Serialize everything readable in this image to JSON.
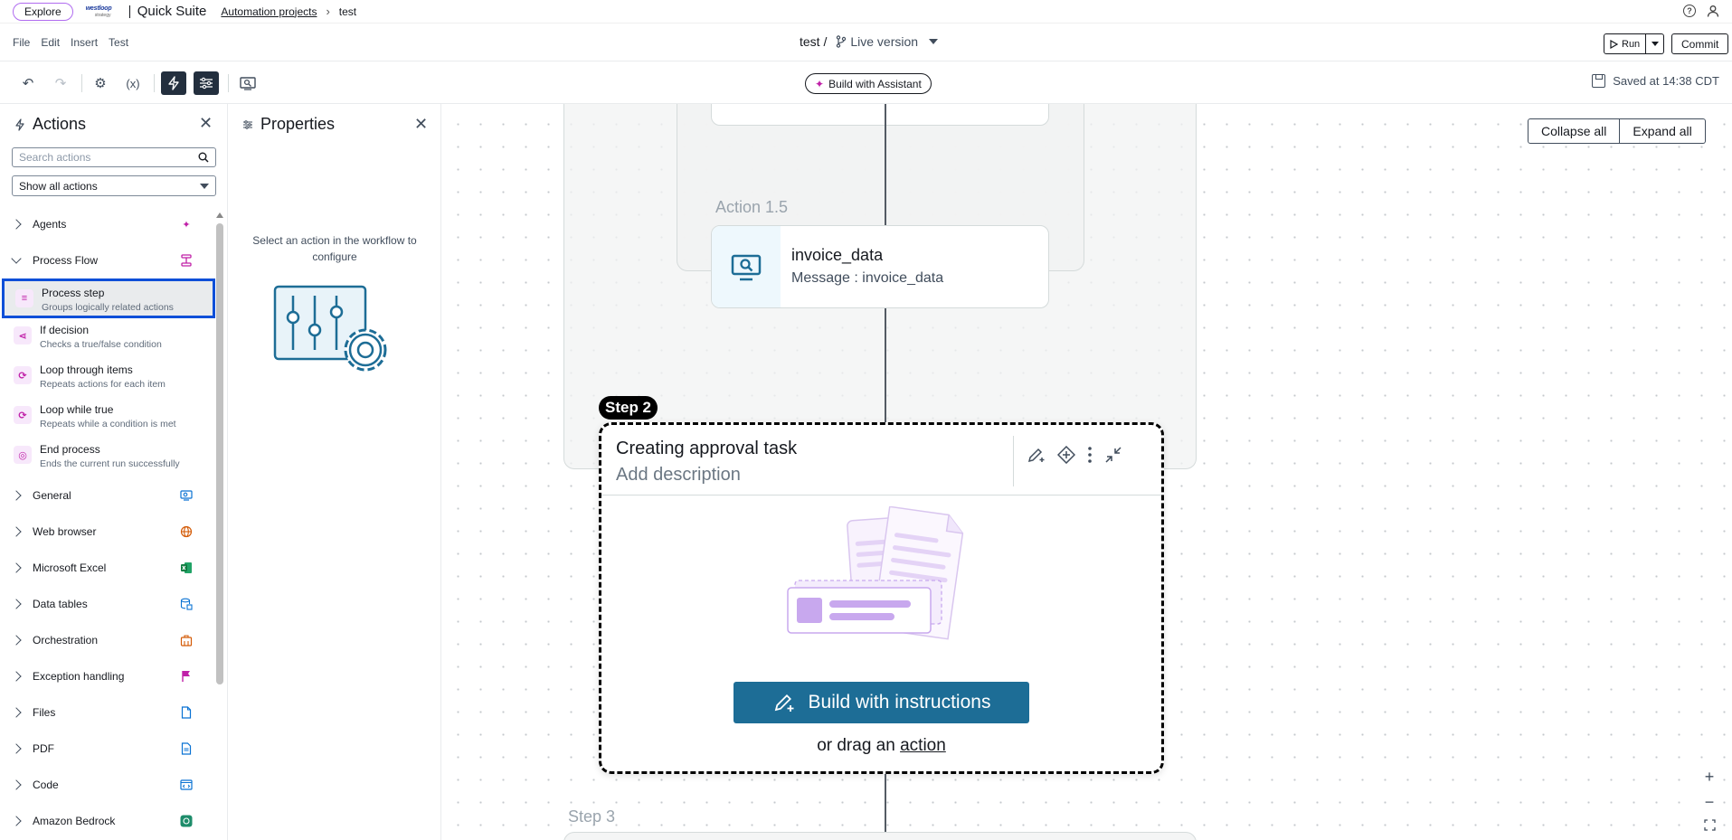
{
  "topbar": {
    "explore": "Explore",
    "logo_main": "westloop",
    "logo_sub": "strategy",
    "suite": "Quick Suite",
    "breadcrumb_link": "Automation projects",
    "breadcrumb_current": "test"
  },
  "menubar": {
    "menus": [
      "File",
      "Edit",
      "Insert",
      "Test"
    ],
    "project": "test /",
    "version": "Live version",
    "run": "Run",
    "commit": "Commit"
  },
  "toolbar": {
    "assistant": "Build with Assistant",
    "saved": "Saved at 14:38 CDT"
  },
  "actions": {
    "title": "Actions",
    "search_placeholder": "Search actions",
    "filter": "Show all actions",
    "categories": [
      {
        "label": "Agents",
        "icon": "sparkle-icon",
        "color": "#c020a8"
      },
      {
        "label": "Process Flow",
        "icon": "process-flow-icon",
        "color": "#c020a8",
        "expanded": true
      },
      {
        "label": "General",
        "icon": "monitor-search-icon",
        "color": "#0972d3"
      },
      {
        "label": "Web browser",
        "icon": "globe-icon",
        "color": "#d45b07"
      },
      {
        "label": "Microsoft Excel",
        "icon": "excel-icon",
        "color": "#1d7d3a"
      },
      {
        "label": "Data tables",
        "icon": "database-icon",
        "color": "#0972d3"
      },
      {
        "label": "Orchestration",
        "icon": "orchestration-icon",
        "color": "#d45b07"
      },
      {
        "label": "Exception handling",
        "icon": "flag-icon",
        "color": "#c020a8"
      },
      {
        "label": "Files",
        "icon": "file-icon",
        "color": "#0972d3"
      },
      {
        "label": "PDF",
        "icon": "pdf-icon",
        "color": "#0972d3"
      },
      {
        "label": "Code",
        "icon": "code-icon",
        "color": "#0972d3"
      },
      {
        "label": "Amazon Bedrock",
        "icon": "bedrock-icon",
        "color": "#1d8c6a"
      }
    ],
    "process_flow_items": [
      {
        "title": "Process step",
        "desc": "Groups logically related actions"
      },
      {
        "title": "If decision",
        "desc": "Checks a true/false condition"
      },
      {
        "title": "Loop through items",
        "desc": "Repeats actions for each item"
      },
      {
        "title": "Loop while true",
        "desc": "Repeats while a condition is met"
      },
      {
        "title": "End process",
        "desc": "Ends the current run successfully"
      }
    ]
  },
  "properties": {
    "title": "Properties",
    "hint": "Select an action in the workflow to configure"
  },
  "canvas": {
    "collapse_all": "Collapse all",
    "expand_all": "Expand all",
    "action_label": "Action 1.5",
    "action_title": "invoice_data",
    "action_sub": "Message : invoice_data",
    "step2_badge": "Step 2",
    "step2_title": "Creating approval task",
    "step2_desc": "Add description",
    "build_instructions": "Build with instructions",
    "drag_prefix": "or drag an",
    "drag_link": "action",
    "step3_label": "Step 3"
  }
}
